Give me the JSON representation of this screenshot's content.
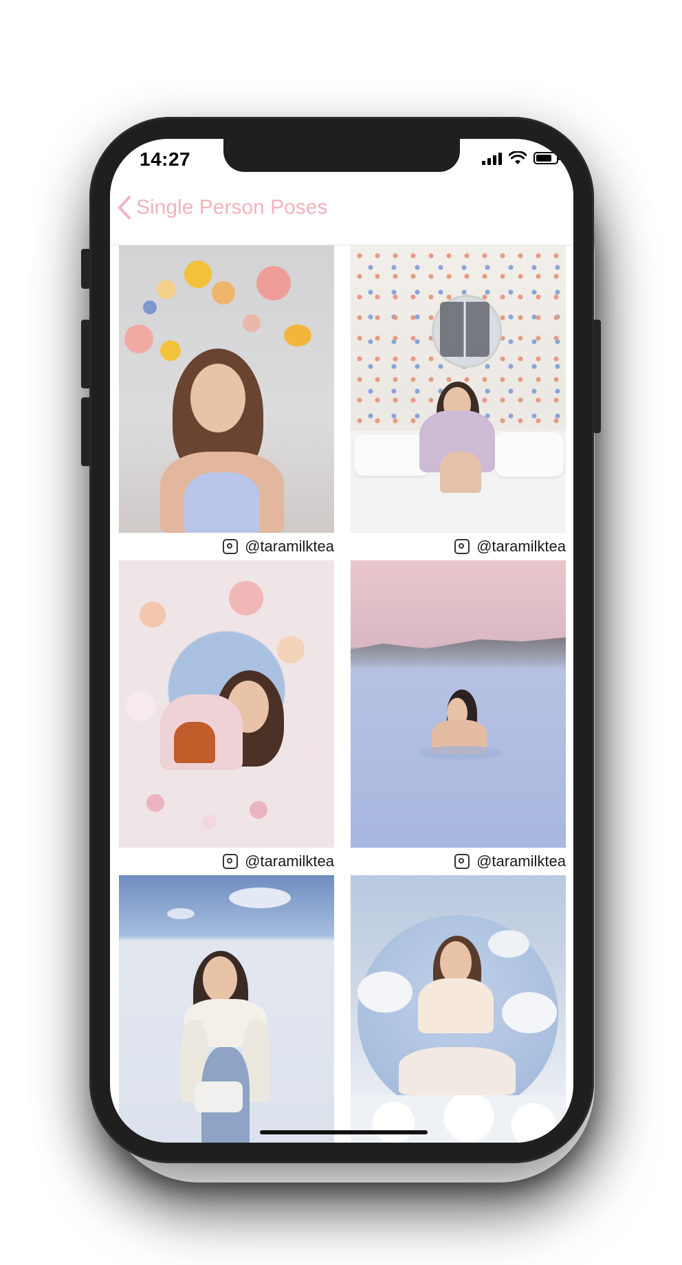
{
  "status_bar": {
    "time": "14:27",
    "signal_icon": "cellular-signal-icon",
    "wifi_icon": "wifi-icon",
    "battery_icon": "battery-icon"
  },
  "nav": {
    "back_icon": "chevron-left-icon",
    "title": "Single Person Poses",
    "accent_color": "#f2b3bd"
  },
  "photos": [
    {
      "credit_icon": "instagram-icon",
      "credit": "@taramilktea"
    },
    {
      "credit_icon": "instagram-icon",
      "credit": "@taramilktea"
    },
    {
      "credit_icon": "instagram-icon",
      "credit": "@taramilktea"
    },
    {
      "credit_icon": "instagram-icon",
      "credit": "@taramilktea"
    },
    {
      "credit_icon": "instagram-icon",
      "credit": ""
    },
    {
      "credit_icon": "instagram-icon",
      "credit": ""
    }
  ]
}
